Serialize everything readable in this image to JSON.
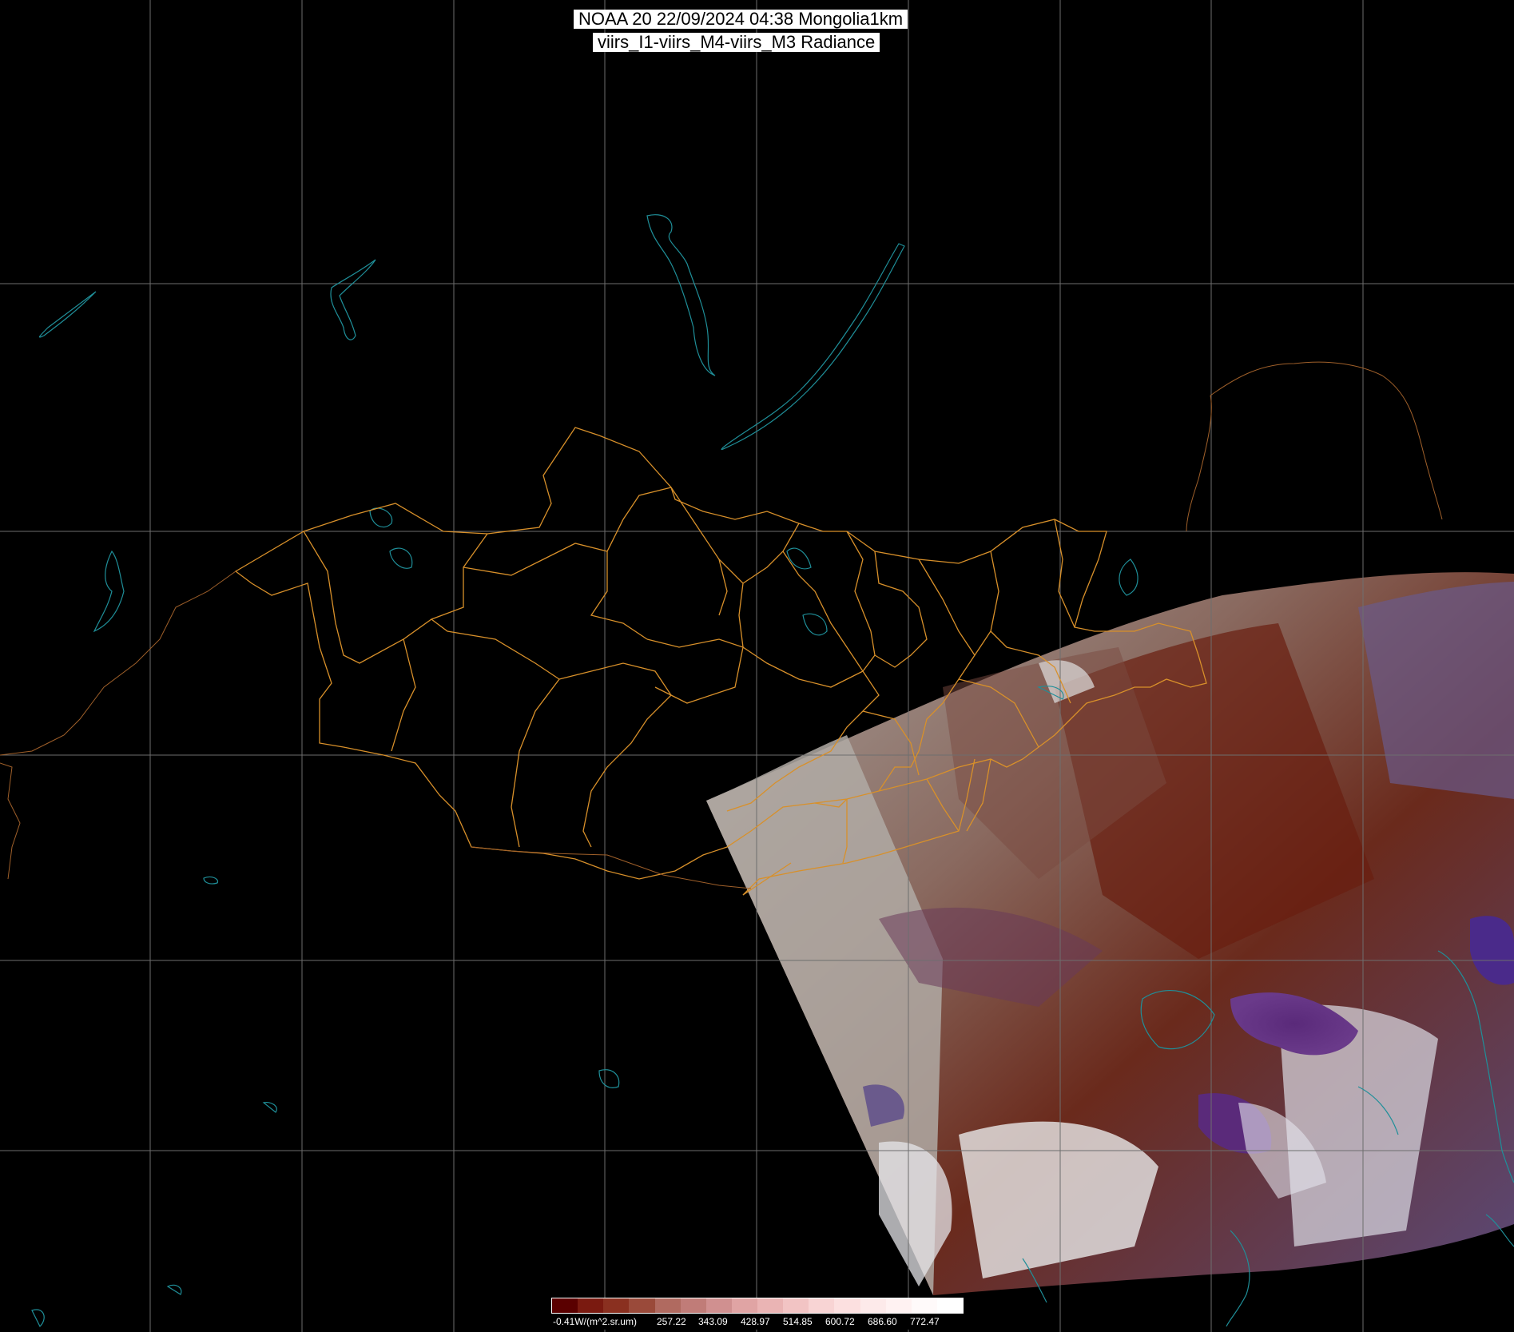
{
  "title": {
    "line1": "NOAA 20 22/09/2024 04:38 Mongolia1km",
    "line2": "viirs_I1-viirs_M4-viirs_M3 Radiance"
  },
  "colorbar": {
    "labels": [
      "-0.41W/(m^2.sr.um)",
      "257.22",
      "343.09",
      "428.97",
      "514.85",
      "600.72",
      "686.60",
      "772.47"
    ],
    "colors": [
      "#5a0000",
      "#7a1a10",
      "#8a3020",
      "#9a4a3a",
      "#b06a60",
      "#c07c78",
      "#d09090",
      "#e0a4a4",
      "#eab4b4",
      "#f2c4c4",
      "#f8d4d4",
      "#fce0e0",
      "#fdeaea",
      "#fff2f2",
      "#fffafa",
      "#ffffff"
    ]
  },
  "style": {
    "grid_color": "#6e6e6e",
    "border_color": "#d8902a",
    "water_color": "#1f8f99"
  }
}
